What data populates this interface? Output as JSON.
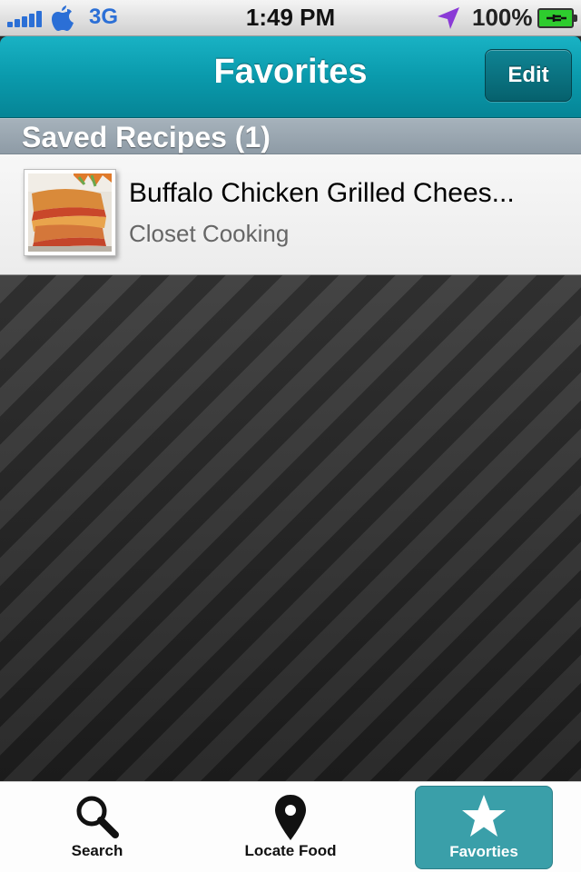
{
  "status_bar": {
    "carrier": "3G",
    "time": "1:49 PM",
    "battery": "100%"
  },
  "nav": {
    "title": "Favorites",
    "edit_label": "Edit"
  },
  "section": {
    "title": "Saved Recipes (1)"
  },
  "recipes": [
    {
      "title": "Buffalo Chicken Grilled Chees...",
      "source": "Closet Cooking"
    }
  ],
  "tabs": [
    {
      "label": "Search",
      "icon": "magnifier-icon",
      "selected": false
    },
    {
      "label": "Locate Food",
      "icon": "map-pin-icon",
      "selected": false
    },
    {
      "label": "Favorties",
      "icon": "star-icon",
      "selected": true
    }
  ],
  "colors": {
    "nav_teal": "#0a9aac",
    "tab_selected": "#3a9fa9",
    "carrier_blue": "#2b6fd6"
  }
}
